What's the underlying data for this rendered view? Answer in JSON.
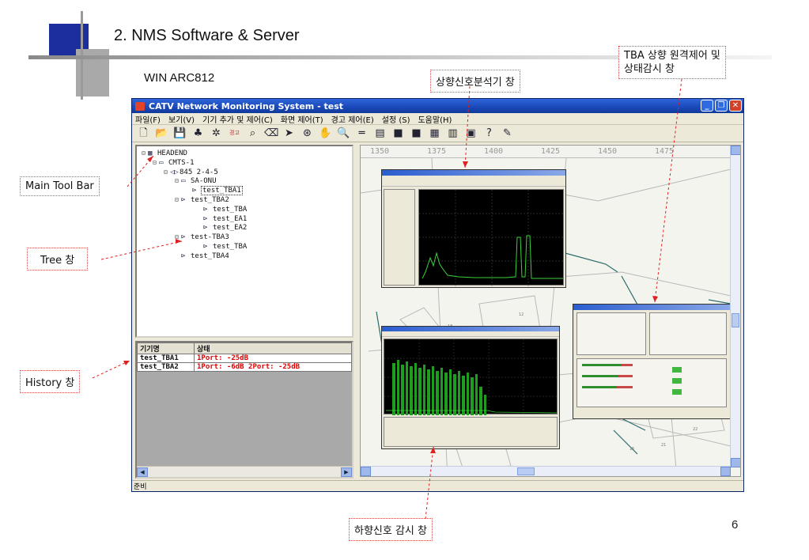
{
  "slide": {
    "title": "2. NMS Software & Server",
    "subtitle": "WIN ARC812",
    "page_number": "6"
  },
  "callouts": {
    "upstream_analyzer": "상향신호분석기 창",
    "tba_remote_line1": "TBA 상향 원격제어 및",
    "tba_remote_line2": "상태감시 창",
    "main_toolbar": "Main Tool Bar",
    "tree": "Tree 창",
    "history": "History 창",
    "downstream_monitor": "하향신호 감시 창"
  },
  "app": {
    "title": "CATV Network Monitoring System - test",
    "menu": [
      "파일(F)",
      "보기(V)",
      "기기 추가 및 제어(C)",
      "화면 제어(T)",
      "경고 제어(E)",
      "설정 (S)",
      "도움말(H)"
    ],
    "toolbar_icons": [
      "new-icon",
      "open-folder-icon",
      "save-icon",
      "device-add-icon",
      "device-config-icon",
      "alarm-icon",
      "zoom-device-icon",
      "remove-device-icon",
      "pointer-icon",
      "link-icon",
      "hand-icon",
      "zoom-icon",
      "line-icon",
      "grid-icon",
      "alarm-device-icon",
      "alarm-device2-icon",
      "screen1-icon",
      "screen2-icon",
      "screen3-icon",
      "help-icon",
      "about-icon"
    ],
    "toolbar_glyphs": [
      "🗋",
      "📂",
      "💾",
      "♣",
      "✲",
      "경고",
      "⌕",
      "⌫",
      "➤",
      "⊛",
      "✋",
      "🔍",
      "═",
      "▤",
      "■",
      "■",
      "▦",
      "▥",
      "▣",
      "?",
      "✎"
    ],
    "tree": [
      {
        "label": "HEADEND",
        "toggle": "⊟",
        "icon": "▦",
        "level": 0
      },
      {
        "label": "CMTS-1",
        "toggle": "⊟",
        "icon": "▭",
        "level": 1
      },
      {
        "label": "845 2-4-5",
        "toggle": "⊟",
        "icon": "◁▷",
        "level": 2
      },
      {
        "label": "SA-ONU",
        "toggle": "⊟",
        "icon": "▭",
        "level": 3
      },
      {
        "label": "test_TBA1",
        "toggle": "",
        "icon": "⊳",
        "level": 4,
        "selected": true
      },
      {
        "label": "test_TBA2",
        "toggle": "⊟",
        "icon": "⊳",
        "level": 3
      },
      {
        "label": "test_TBA",
        "toggle": "",
        "icon": "⊳",
        "level": 5
      },
      {
        "label": "test_EA1",
        "toggle": "",
        "icon": "⊳",
        "level": 5
      },
      {
        "label": "test_EA2",
        "toggle": "",
        "icon": "⊳",
        "level": 5
      },
      {
        "label": "test-TBA3",
        "toggle": "⊟",
        "icon": "⊳",
        "level": 3
      },
      {
        "label": "test_TBA",
        "toggle": "",
        "icon": "⊳",
        "level": 5
      },
      {
        "label": "test_TBA4",
        "toggle": "",
        "icon": "⊳",
        "level": 3
      }
    ],
    "history": {
      "headers": [
        "기기명",
        "상태"
      ],
      "rows": [
        {
          "name": "test_TBA1",
          "status": "1Port: -25dB"
        },
        {
          "name": "test_TBA2",
          "status": "1Port: -6dB 2Port: -25dB"
        }
      ]
    },
    "ruler_labels": [
      "1350",
      "1375",
      "1400",
      "1425",
      "1450",
      "1475"
    ],
    "status_text": "준비"
  },
  "colors": {
    "accent_blue": "#1c2e9b",
    "callout_border": "#e05050",
    "status_red": "#e00000",
    "spectrum_green": "#22c022"
  }
}
